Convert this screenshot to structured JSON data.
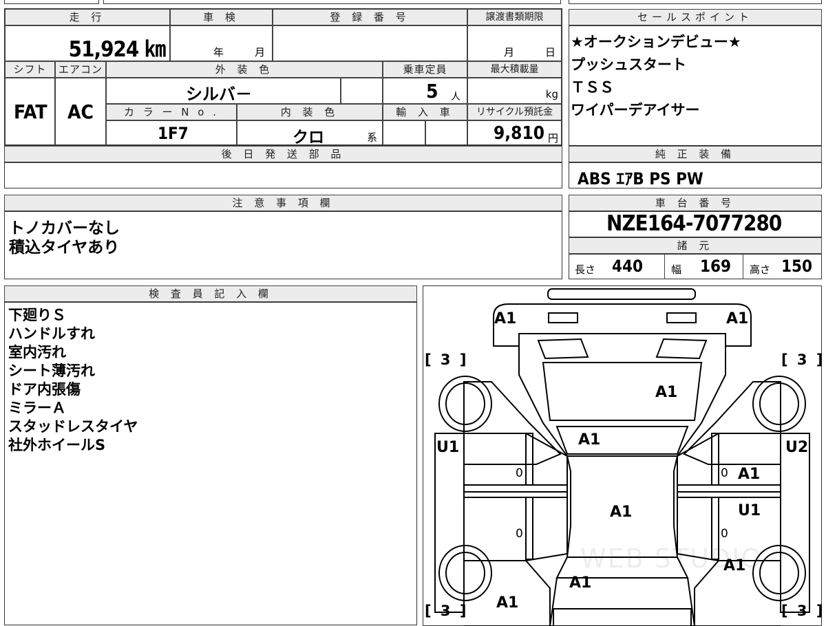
{
  "header": {
    "mileage_label": "走 行",
    "inspection_label": "車 検",
    "registration_label": "登 録 番 号",
    "transfer_deadline_label": "譲渡書類期限",
    "sales_point_label": "セールスポイント"
  },
  "vehicle": {
    "mileage": "51,924 ㎞",
    "inspection_year_unit": "年",
    "inspection_month_unit": "月",
    "transfer_month_unit": "月",
    "transfer_day_unit": "日",
    "shift_label": "シフト",
    "ac_label": "エアコン",
    "exterior_color_label": "外 装 色",
    "capacity_label": "乗車定員",
    "max_load_label": "最大積載量",
    "shift": "FAT",
    "ac": "AC",
    "exterior_color": "シルバ－",
    "capacity": "5",
    "capacity_unit": "人",
    "max_load_unit": "kg",
    "color_no_label": "カ ラ ー N o .",
    "interior_color_label": "内 装 色",
    "import_label": "輸 入 車",
    "recycle_label": "リサイクル預託金",
    "color_no": "1F7",
    "interior_color": "クロ",
    "interior_suffix": "系",
    "recycle_fee": "9,810",
    "recycle_unit": "円"
  },
  "later_parts": {
    "label": "後 日 発 送 部 品",
    "value": ""
  },
  "sales_points": {
    "items": [
      "★オークションデビュー★",
      "プッシュスタート",
      "ＴＳＳ",
      "ワイパーデアイサー"
    ]
  },
  "genuine_equipment": {
    "label": "純 正 装 備",
    "value": "ABS ｴｱB PS PW"
  },
  "notes": {
    "label": "注 意 事 項 欄",
    "lines": [
      "トノカバーなし",
      "積込タイヤあり"
    ]
  },
  "chassis": {
    "label": "車 台 番 号",
    "number": "NZE164-7077280"
  },
  "specs": {
    "label": "諸 元",
    "length_label": "長さ",
    "length": "440",
    "width_label": "幅",
    "width": "169",
    "height_label": "高さ",
    "height": "150"
  },
  "inspector": {
    "label": "検 査 員 記 入 欄",
    "lines": [
      "下廻りＳ",
      "ハンドルすれ",
      "室内汚れ",
      "シート薄汚れ",
      "ドア内張傷",
      "ミラーＡ",
      "スタッドレスタイヤ",
      "社外ホイールS"
    ]
  },
  "diagram": {
    "marks": {
      "front_left_corner": "A1",
      "front_right_corner": "A1",
      "hood": "A1",
      "windshield": "A1",
      "roof": "A1",
      "rear_left_door": "A1",
      "rear_right_door": "A1",
      "left_front_fender": "U1",
      "right_front_fender": "U2",
      "right_front_door": "A1",
      "right_rear_door": "U1",
      "trunk": "A1",
      "rear_left_corner": "A1",
      "tire_fl": "[ 3 ]",
      "tire_fr": "[ 3 ]",
      "tire_rl": "[ 3 ]",
      "tire_rr": "[ 3 ]",
      "door_zero": "0"
    },
    "watermark": "WEB STUDIO"
  }
}
